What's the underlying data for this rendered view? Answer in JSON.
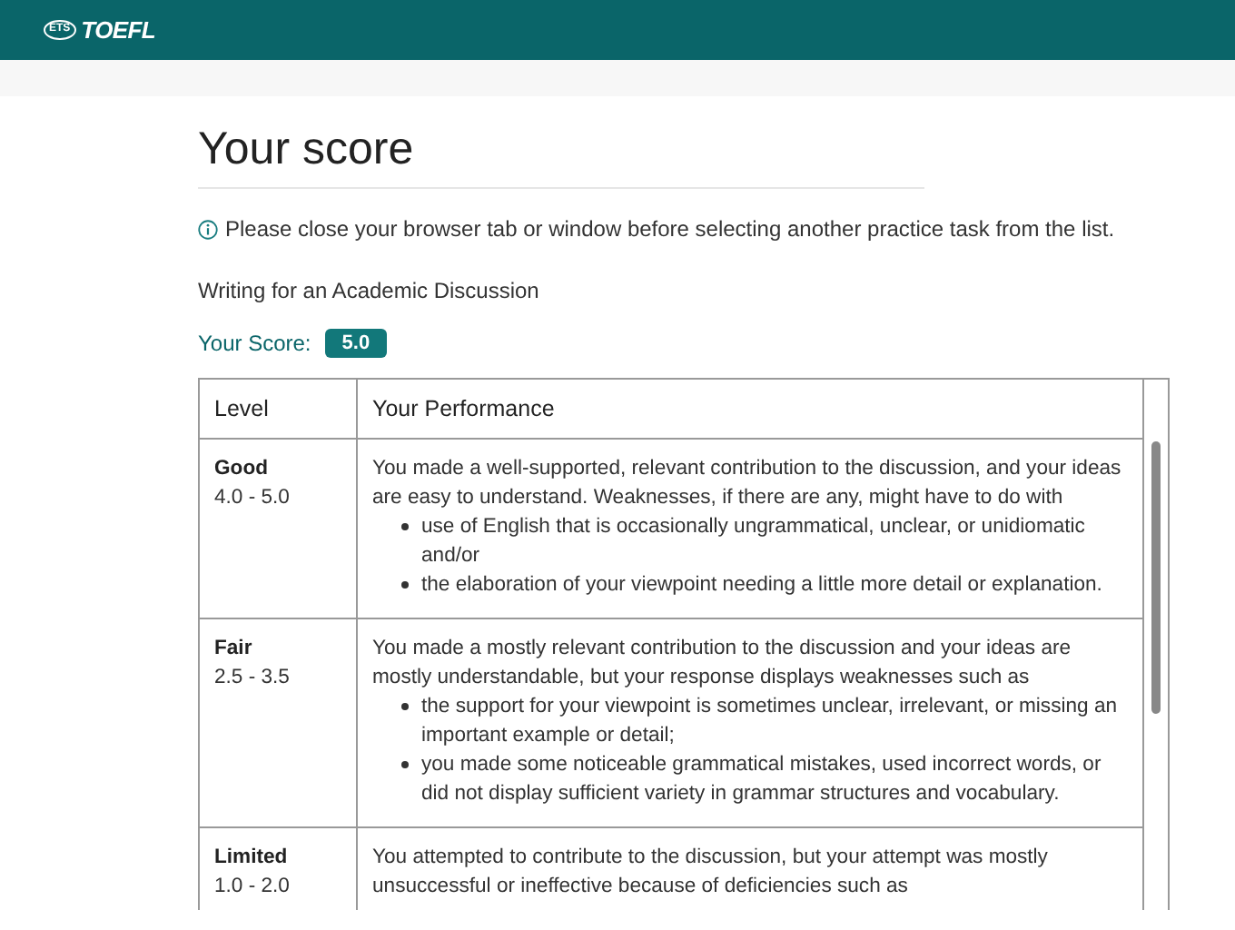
{
  "header": {
    "logo_mark": "ETS",
    "logo_text": "TOEFL"
  },
  "title": "Your score",
  "notice": "Please close your browser tab or window before selecting another practice task from the list.",
  "task": "Writing for an Academic Discussion",
  "score": {
    "label": "Your Score:",
    "value": "5.0"
  },
  "table": {
    "columns": [
      "Level",
      "Your Performance"
    ],
    "rows": [
      {
        "level": "Good",
        "range": "4.0 - 5.0",
        "text": "You made a well-supported, relevant contribution to the discussion, and your ideas are easy to understand. Weaknesses, if there are any, might have to do with",
        "bullets": [
          "use of English that is occasionally ungrammatical, unclear, or unidiomatic and/or",
          "the elaboration of your viewpoint needing a little more detail or explanation."
        ]
      },
      {
        "level": "Fair",
        "range": "2.5 - 3.5",
        "text": "You made a mostly relevant contribution to the discussion and your ideas are mostly understandable, but your response displays weaknesses such as",
        "bullets": [
          "the support for your viewpoint is sometimes unclear, irrelevant, or missing an important example or detail;",
          "you made some noticeable grammatical mistakes, used incorrect words, or did not display sufficient variety in grammar structures and vocabulary."
        ]
      },
      {
        "level": "Limited",
        "range": "1.0 - 2.0",
        "text": "You attempted to contribute to the discussion, but your attempt was mostly unsuccessful or ineffective because of deficiencies such as",
        "bullets": []
      }
    ]
  }
}
